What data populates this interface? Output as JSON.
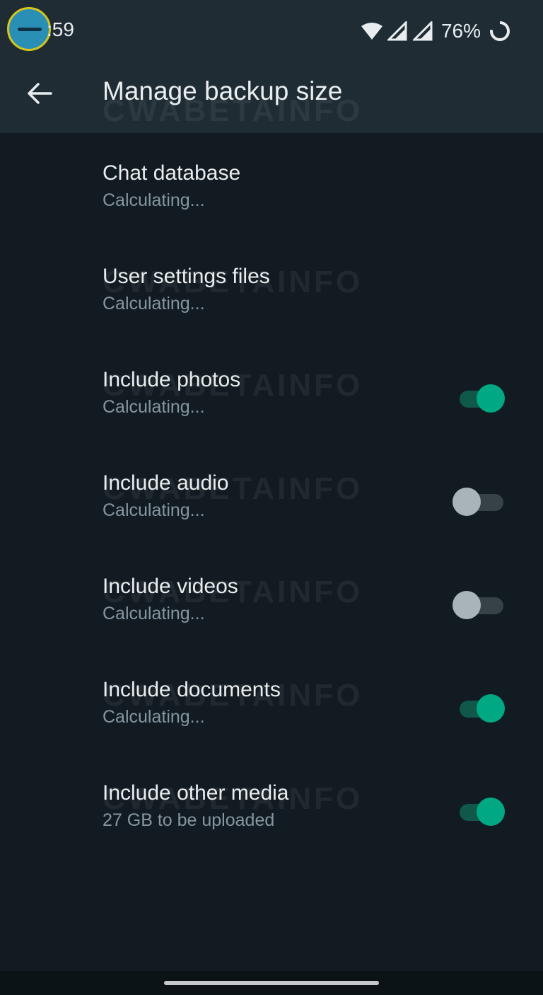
{
  "status_bar": {
    "time": ":59",
    "battery_percent": "76%",
    "icons": [
      "wifi-icon",
      "signal-icon",
      "signal-icon",
      "battery-ring-icon"
    ]
  },
  "app_bar": {
    "back_icon": "arrow-left-icon",
    "title": "Manage backup size"
  },
  "watermark": "CWABETAINFO",
  "items": [
    {
      "title": "Chat database",
      "subtitle": "Calculating...",
      "toggle": null
    },
    {
      "title": "User settings files",
      "subtitle": "Calculating...",
      "toggle": null
    },
    {
      "title": "Include photos",
      "subtitle": "Calculating...",
      "toggle": true
    },
    {
      "title": "Include audio",
      "subtitle": "Calculating...",
      "toggle": false
    },
    {
      "title": "Include videos",
      "subtitle": "Calculating...",
      "toggle": false
    },
    {
      "title": "Include documents",
      "subtitle": "Calculating...",
      "toggle": true
    },
    {
      "title": "Include other media",
      "subtitle": "27 GB to be uploaded",
      "toggle": true
    }
  ],
  "colors": {
    "background": "#121b22",
    "app_bar": "#1f2c34",
    "accent": "#00a884",
    "text_primary": "#e9edef",
    "text_secondary": "#8696a0"
  }
}
